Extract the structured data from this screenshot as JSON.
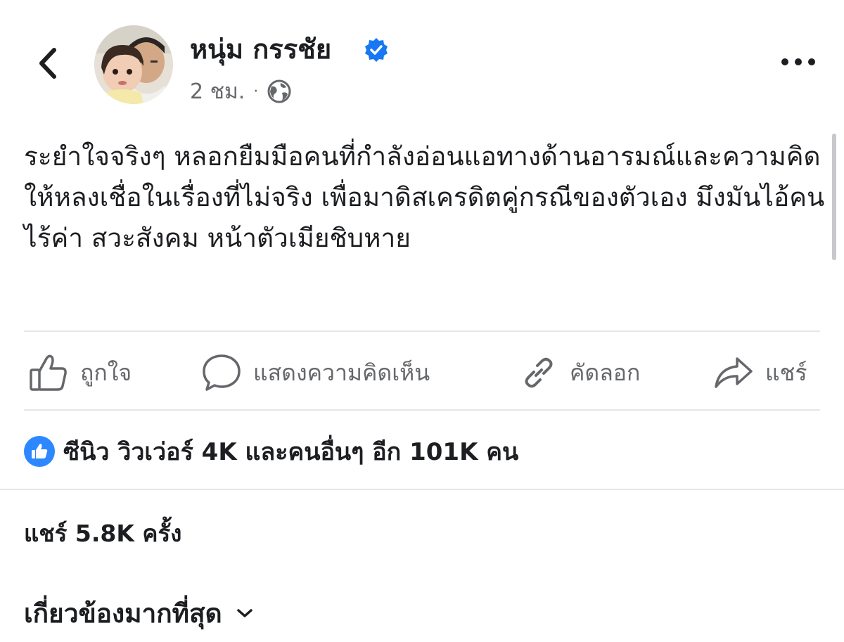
{
  "author": {
    "name": "หนุ่ม กรรชัย",
    "verified": true,
    "time": "2 ชม.",
    "separator": "·",
    "privacy_icon": "globe-icon"
  },
  "post": {
    "text": "ระยำใจจริงๆ หลอกยืมมือคนที่กำลังอ่อนแอทางด้านอารมณ์และความคิด ให้หลงเชื่อในเรื่องที่ไม่จริง เพื่อมาดิสเครดิตคู่กรณีของตัวเอง มึงมันไอ้คนไร้ค่า สวะสังคม หน้าตัวเมียชิบหาย"
  },
  "actions": {
    "like": "ถูกใจ",
    "comment": "แสดงความคิดเห็น",
    "copy": "คัดลอก",
    "share": "แชร์"
  },
  "reactions": {
    "summary": "ซีนิว วิวเว่อร์ 4K และคนอื่นๆ อีก 101K คน"
  },
  "shares": {
    "text": "แชร์ 5.8K ครั้ง"
  },
  "comments_sort": {
    "label": "เกี่ยวข้องมากที่สุด"
  },
  "colors": {
    "brand_blue": "#1877f2",
    "like_badge": "#2d88ff",
    "secondary_text": "#65676b",
    "divider": "#e4e6eb"
  }
}
